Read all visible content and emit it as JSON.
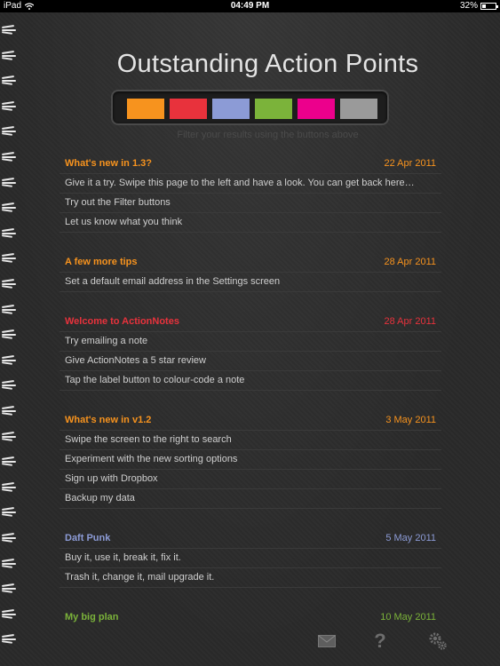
{
  "statusbar": {
    "device": "iPad",
    "time": "04:49 PM",
    "battery": "32%"
  },
  "page_title": "Outstanding Action Points",
  "filters": [
    {
      "name": "orange",
      "color": "#f7931e"
    },
    {
      "name": "red",
      "color": "#e8323c"
    },
    {
      "name": "blue",
      "color": "#8c9bd6"
    },
    {
      "name": "green",
      "color": "#7bb33a"
    },
    {
      "name": "pink",
      "color": "#ec008c"
    },
    {
      "name": "grey",
      "color": "#9a9a9a"
    }
  ],
  "filter_hint": "Filter your results using the buttons above",
  "groups": [
    {
      "title": "What's new in 1.3?",
      "date": "22 Apr 2011",
      "color": "#f7931e",
      "items": [
        "Give it a try. Swipe this page to the left and have a look. You can get back here…",
        "Try out the Filter buttons",
        "Let us know what you think"
      ]
    },
    {
      "title": "A few more tips",
      "date": "28 Apr 2011",
      "color": "#f7931e",
      "items": [
        "Set a default email address in the Settings screen"
      ]
    },
    {
      "title": "Welcome to ActionNotes",
      "date": "28 Apr 2011",
      "color": "#e8323c",
      "items": [
        "Try emailing a note",
        "Give ActionNotes a 5 star review",
        "Tap the label button to colour-code a note"
      ]
    },
    {
      "title": "What's new in v1.2",
      "date": "3 May 2011",
      "color": "#f7931e",
      "items": [
        "Swipe the screen to the right to search",
        "Experiment with the new sorting options",
        "Sign up with Dropbox",
        "Backup my data"
      ]
    },
    {
      "title": "Daft Punk",
      "date": "5 May 2011",
      "color": "#8c9bd6",
      "items": [
        "Buy it, use it, break it, fix it.",
        "Trash it, change it, mail upgrade it."
      ]
    },
    {
      "title": "My big plan",
      "date": "10 May 2011",
      "color": "#7bb33a",
      "items": []
    }
  ],
  "toolbar": {
    "mail_icon": "envelope-icon",
    "help_icon": "question-mark-icon",
    "settings_icon": "gears-icon",
    "help_glyph": "?"
  }
}
